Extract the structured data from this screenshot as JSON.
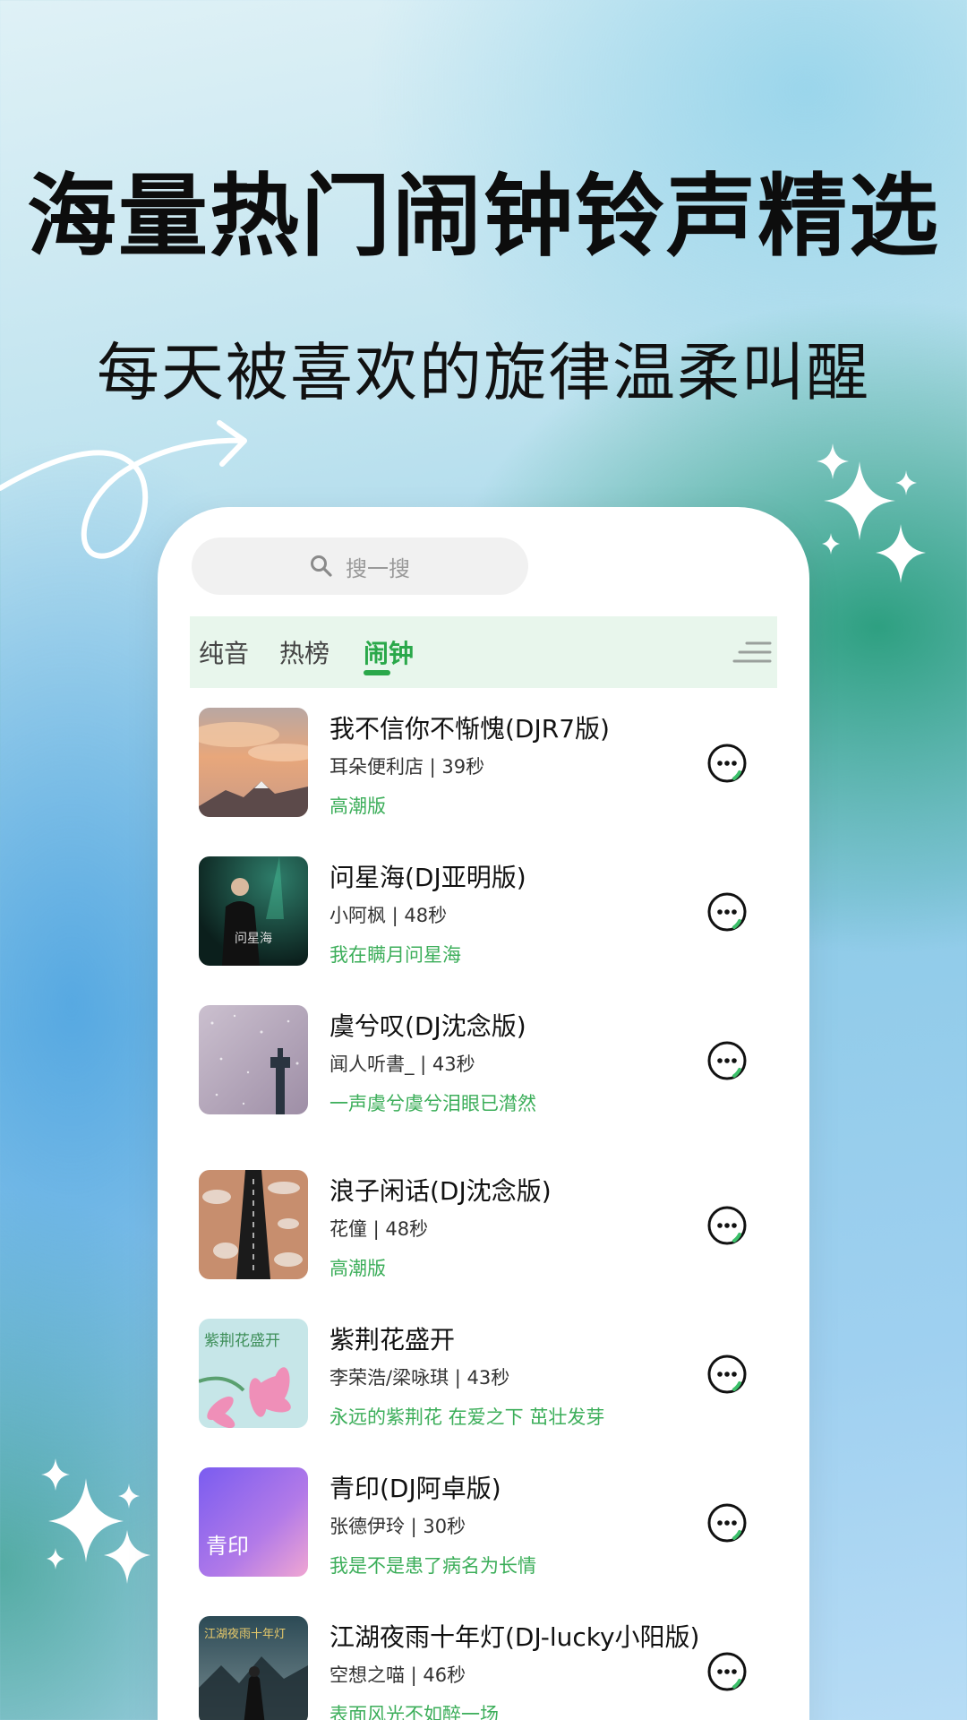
{
  "headline": "海量热门闹钟铃声精选",
  "subheadline": "每天被喜欢的旋律温柔叫醒",
  "search": {
    "placeholder": "搜一搜"
  },
  "tabs": [
    {
      "label": "纯音",
      "active": false
    },
    {
      "label": "热榜",
      "active": false
    },
    {
      "label": "闹钟",
      "active": true
    }
  ],
  "songs": [
    {
      "title": "我不信你不惭愧(DJR7版)",
      "meta": "耳朵便利店 | 39秒",
      "tag": "高潮版"
    },
    {
      "title": "问星海(DJ亚明版)",
      "meta": "小阿枫 | 48秒",
      "tag": "我在瞒月问星海"
    },
    {
      "title": "虞兮叹(DJ沈念版)",
      "meta": "闻人听書_ | 43秒",
      "tag": "一声虞兮虞兮泪眼已潸然"
    },
    {
      "title": "浪子闲话(DJ沈念版)",
      "meta": "花僮 | 48秒",
      "tag": "高潮版"
    },
    {
      "title": "紫荆花盛开",
      "meta": "李荣浩/梁咏琪 | 43秒",
      "tag": "永远的紫荆花 在爱之下 茁壮发芽"
    },
    {
      "title": "青印(DJ阿卓版)",
      "meta": "张德伊玲 | 30秒",
      "tag": "我是不是患了病名为长情"
    },
    {
      "title": "江湖夜雨十年灯(DJ-lucky小阳版)",
      "meta": "空想之喵 | 46秒",
      "tag": "表面风光不如醉一场"
    }
  ],
  "cover_texts": {
    "s2": "问星海",
    "s5": "紫荆花盛开",
    "s6": "青印",
    "s7": "江湖夜雨十年灯"
  },
  "colors": {
    "accent": "#2aa84a",
    "tab_bg": "#e8f6ec",
    "tag": "#3cae5a"
  }
}
